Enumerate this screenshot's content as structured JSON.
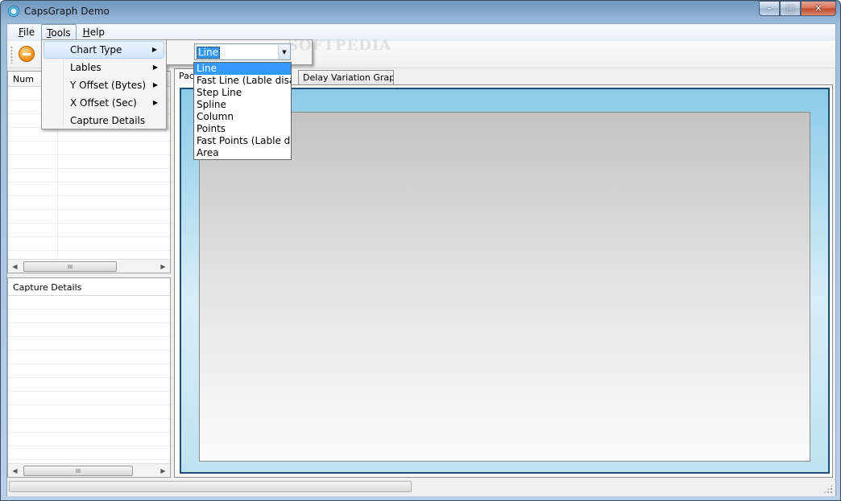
{
  "window": {
    "title": "CapsGraph Demo",
    "controls": {
      "minimize": "–",
      "maximize": "□",
      "close": "✕"
    }
  },
  "menubar": {
    "items": [
      {
        "label": "File",
        "accel": "F",
        "rest": "ile"
      },
      {
        "label": "Tools",
        "accel": "T",
        "rest": "ools"
      },
      {
        "label": "Help",
        "accel": "H",
        "rest": "elp"
      }
    ]
  },
  "toolbar": {
    "stop_icon": "stop-circle-icon"
  },
  "packets_grid": {
    "columns": [
      "Num"
    ],
    "scroll_thumb": "III"
  },
  "capture_panel": {
    "header": "Capture Details",
    "scroll_thumb": "III"
  },
  "tabs": [
    {
      "label": "Pac",
      "selected": true
    },
    {
      "label": "Delay Variation Graph",
      "selected": false
    }
  ],
  "tools_menu": {
    "items": [
      {
        "label": "Chart Type",
        "has_submenu": true
      },
      {
        "label": "Lables",
        "has_submenu": true
      },
      {
        "label": "Y Offset (Bytes)",
        "has_submenu": true
      },
      {
        "label": "X Offset (Sec)",
        "has_submenu": true
      },
      {
        "label": "Capture Details",
        "has_submenu": false
      }
    ]
  },
  "chart_type_combo": {
    "selected": "Line",
    "options": [
      "Line",
      "Fast Line (Lable disable",
      "Step Line",
      "Spline",
      "Column",
      "Points",
      "Fast Points (Lable disa",
      "Area"
    ]
  },
  "watermark": "SOFTPEDIA",
  "colors": {
    "selection": "#3399ff",
    "chart_border": "#1f4d7a",
    "chart_bg_top": "#8ccbe8"
  }
}
